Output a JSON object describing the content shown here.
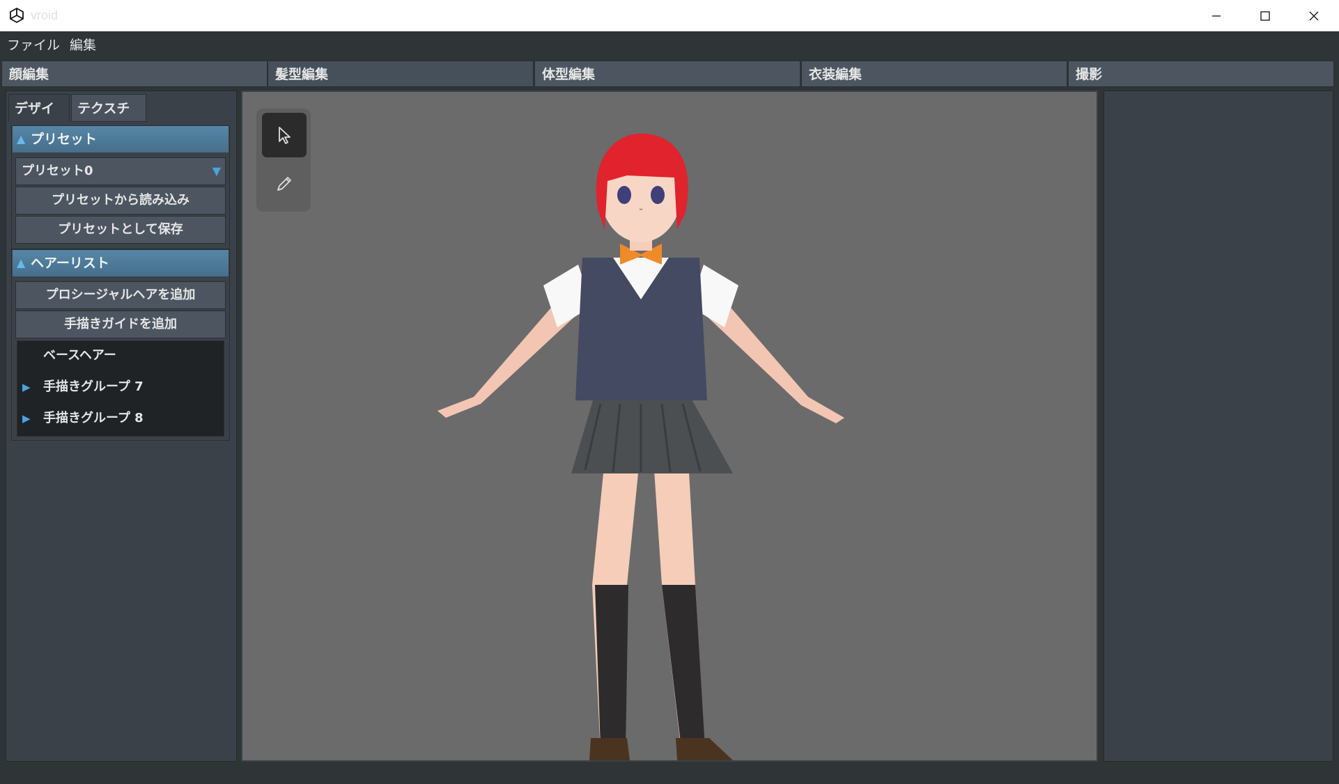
{
  "window": {
    "title": "vroid",
    "controls": {
      "minimize": "—",
      "maximize": "☐",
      "close": "✕"
    }
  },
  "menu": {
    "file": "ファイル",
    "edit": "編集"
  },
  "main_tabs": [
    {
      "label": "顔編集"
    },
    {
      "label": "髪型編集"
    },
    {
      "label": "体型編集"
    },
    {
      "label": "衣装編集"
    },
    {
      "label": "撮影"
    }
  ],
  "left_panel": {
    "sub_tabs": [
      {
        "label": "デザイン"
      },
      {
        "label": "テクスチャ"
      }
    ],
    "preset_section": {
      "title": "プリセット",
      "selected_preset": "プリセット0",
      "load_button": "プリセットから読み込み",
      "save_button": "プリセットとして保存"
    },
    "hair_section": {
      "title": "ヘアーリスト",
      "add_procedural_button": "プロシージャルヘアを追加",
      "add_guide_button": "手描きガイドを追加",
      "items": [
        {
          "label": "ベースヘアー"
        },
        {
          "label": "手描きグループ 7"
        },
        {
          "label": "手描きグループ 8"
        }
      ]
    }
  },
  "colors": {
    "accent": "#4aa4e2",
    "viewport_bg": "#6b6b6b",
    "panel_bg": "#3a4148",
    "section_header": "#4f7e9e"
  }
}
